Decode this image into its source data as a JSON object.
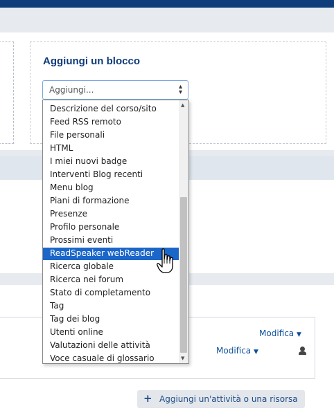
{
  "block_panel": {
    "title": "Aggiungi un blocco",
    "select_value": "Aggiungi...",
    "options": [
      "Descrizione del corso/sito",
      "Feed RSS remoto",
      "File personali",
      "HTML",
      "I miei nuovi badge",
      "Interventi Blog recenti",
      "Menu blog",
      "Piani di formazione",
      "Presenze",
      "Profilo personale",
      "Prossimi eventi",
      "ReadSpeaker webReader",
      "Ricerca globale",
      "Ricerca nei forum",
      "Stato di completamento",
      "Tag",
      "Tag dei blog",
      "Utenti online",
      "Valutazioni delle attività",
      "Voce casuale di glossario"
    ],
    "selected_option": "ReadSpeaker webReader"
  },
  "course": {
    "edit_label_1": "Modifica",
    "edit_label_2": "Modifica",
    "add_activity_label": "Aggiungi un'attività o una risorsa"
  },
  "colors": {
    "brand": "#0f3c7a",
    "selection": "#1b66c9",
    "link": "#0f4f9a",
    "background": "#e7ebf0"
  },
  "icons": [
    "select-caret-icon",
    "caret-down-icon",
    "user-icon",
    "plus-icon",
    "hand-pointer-icon"
  ]
}
